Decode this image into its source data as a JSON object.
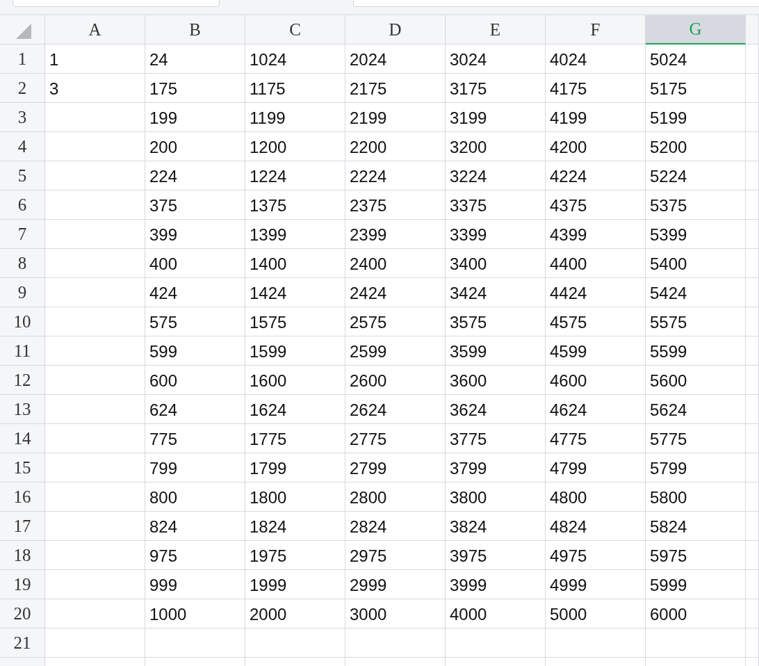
{
  "columns": [
    {
      "label": "A",
      "selected": false
    },
    {
      "label": "B",
      "selected": false
    },
    {
      "label": "C",
      "selected": false
    },
    {
      "label": "D",
      "selected": false
    },
    {
      "label": "E",
      "selected": false
    },
    {
      "label": "F",
      "selected": false
    },
    {
      "label": "G",
      "selected": true
    }
  ],
  "rows": [
    {
      "header": "1",
      "cells": [
        "1",
        "24",
        "1024",
        "2024",
        "3024",
        "4024",
        "5024"
      ]
    },
    {
      "header": "2",
      "cells": [
        "3",
        "175",
        "1175",
        "2175",
        "3175",
        "4175",
        "5175"
      ]
    },
    {
      "header": "3",
      "cells": [
        null,
        "199",
        "1199",
        "2199",
        "3199",
        "4199",
        "5199"
      ]
    },
    {
      "header": "4",
      "cells": [
        null,
        "200",
        "1200",
        "2200",
        "3200",
        "4200",
        "5200"
      ]
    },
    {
      "header": "5",
      "cells": [
        null,
        "224",
        "1224",
        "2224",
        "3224",
        "4224",
        "5224"
      ]
    },
    {
      "header": "6",
      "cells": [
        null,
        "375",
        "1375",
        "2375",
        "3375",
        "4375",
        "5375"
      ]
    },
    {
      "header": "7",
      "cells": [
        null,
        "399",
        "1399",
        "2399",
        "3399",
        "4399",
        "5399"
      ]
    },
    {
      "header": "8",
      "cells": [
        null,
        "400",
        "1400",
        "2400",
        "3400",
        "4400",
        "5400"
      ]
    },
    {
      "header": "9",
      "cells": [
        null,
        "424",
        "1424",
        "2424",
        "3424",
        "4424",
        "5424"
      ]
    },
    {
      "header": "10",
      "cells": [
        null,
        "575",
        "1575",
        "2575",
        "3575",
        "4575",
        "5575"
      ]
    },
    {
      "header": "11",
      "cells": [
        null,
        "599",
        "1599",
        "2599",
        "3599",
        "4599",
        "5599"
      ]
    },
    {
      "header": "12",
      "cells": [
        null,
        "600",
        "1600",
        "2600",
        "3600",
        "4600",
        "5600"
      ]
    },
    {
      "header": "13",
      "cells": [
        null,
        "624",
        "1624",
        "2624",
        "3624",
        "4624",
        "5624"
      ]
    },
    {
      "header": "14",
      "cells": [
        null,
        "775",
        "1775",
        "2775",
        "3775",
        "4775",
        "5775"
      ]
    },
    {
      "header": "15",
      "cells": [
        null,
        "799",
        "1799",
        "2799",
        "3799",
        "4799",
        "5799"
      ]
    },
    {
      "header": "16",
      "cells": [
        null,
        "800",
        "1800",
        "2800",
        "3800",
        "4800",
        "5800"
      ]
    },
    {
      "header": "17",
      "cells": [
        null,
        "824",
        "1824",
        "2824",
        "3824",
        "4824",
        "5824"
      ]
    },
    {
      "header": "18",
      "cells": [
        null,
        "975",
        "1975",
        "2975",
        "3975",
        "4975",
        "5975"
      ]
    },
    {
      "header": "19",
      "cells": [
        null,
        "999",
        "1999",
        "2999",
        "3999",
        "4999",
        "5999"
      ]
    },
    {
      "header": "20",
      "cells": [
        null,
        "1000",
        "2000",
        "3000",
        "4000",
        "5000",
        "6000"
      ]
    },
    {
      "header": "21",
      "cells": [
        null,
        null,
        null,
        null,
        null,
        null,
        null
      ]
    }
  ]
}
